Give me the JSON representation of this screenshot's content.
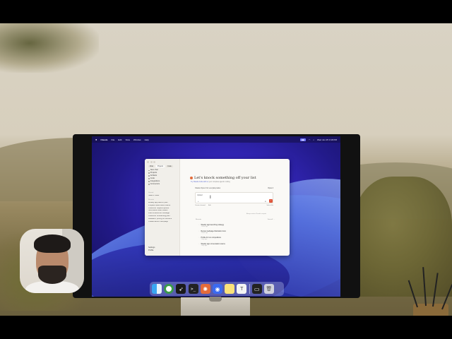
{
  "menubar": {
    "app_name": "Claude",
    "menus": [
      "File",
      "Edit",
      "View",
      "Window",
      "Help"
    ],
    "status_pill": "■■",
    "clock": "Wed Jun 25 3:18 PM"
  },
  "desktop": {
    "top_right_label": "What's New"
  },
  "window": {
    "sidebar": {
      "tabs": [
        "Chat",
        "Projects",
        "Code"
      ],
      "nav": [
        "New chat",
        "Projects",
        "Artifacts",
        "Code",
        "Integrations",
        "Connectors"
      ],
      "starred_label": "Starred",
      "starred": [
        "Search chats"
      ],
      "recents_label": "Recents",
      "recents": [
        "Weekly app launch plan",
        "Prepare board deck outline",
        "Customer request quotes",
        "Summarize team status",
        "Draft a welcome message",
        "Customer onboarding plan",
        "Research pricing for vendors",
        "Create launch campaign"
      ],
      "bottom": [
        "Settings",
        "Profile"
      ]
    },
    "main": {
      "heading": "Let's knock something off your list",
      "subhead_link": "Try Claude Code with us",
      "subhead_rest": "your complete agentic coding",
      "composer": {
        "model_label": "Claude Opus 4 for everyday tasks",
        "model_menu": "Opus 4",
        "input_label": "Upload",
        "cursor": "I",
        "plus": "+",
        "mic": "●",
        "send": "↑",
        "actions": [
          "Create channel",
          "Edit"
        ],
        "right_action": "Select file"
      },
      "note": "Always review Claude's outputs",
      "recents_label": "Recents",
      "recents_view_all": "View all →",
      "recent_items": [
        {
          "title": "Weekly app launching strategy",
          "subtitle": "1 hour ago"
        },
        {
          "title": "Review webpage illustration docs",
          "subtitle": "1 hour ago"
        },
        {
          "title": "Profile for run competitions",
          "subtitle": "1 day ago"
        },
        {
          "title": "Weekly app conversation source",
          "subtitle": "1 day ago"
        }
      ]
    }
  },
  "dock": {
    "apps": [
      "finder",
      "chrome",
      "safari",
      "terminal",
      "claude",
      "zoom",
      "notes",
      "textedit",
      "screen",
      "trash"
    ]
  }
}
